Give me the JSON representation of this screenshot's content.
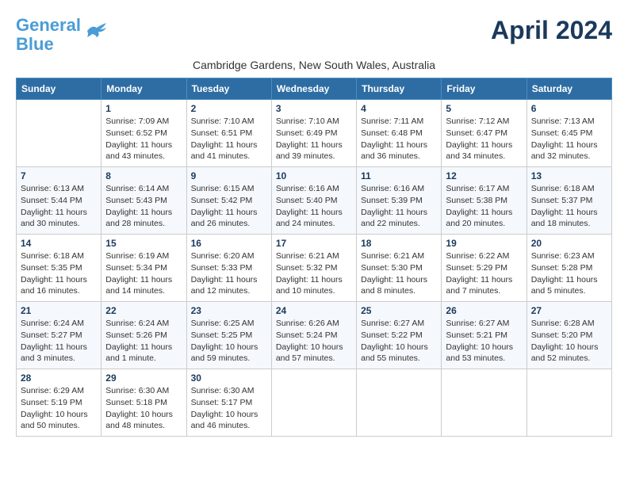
{
  "header": {
    "logo_line1": "General",
    "logo_line2": "Blue",
    "month_title": "April 2024",
    "location": "Cambridge Gardens, New South Wales, Australia"
  },
  "weekdays": [
    "Sunday",
    "Monday",
    "Tuesday",
    "Wednesday",
    "Thursday",
    "Friday",
    "Saturday"
  ],
  "weeks": [
    [
      {
        "day": "",
        "info": ""
      },
      {
        "day": "1",
        "info": "Sunrise: 7:09 AM\nSunset: 6:52 PM\nDaylight: 11 hours\nand 43 minutes."
      },
      {
        "day": "2",
        "info": "Sunrise: 7:10 AM\nSunset: 6:51 PM\nDaylight: 11 hours\nand 41 minutes."
      },
      {
        "day": "3",
        "info": "Sunrise: 7:10 AM\nSunset: 6:49 PM\nDaylight: 11 hours\nand 39 minutes."
      },
      {
        "day": "4",
        "info": "Sunrise: 7:11 AM\nSunset: 6:48 PM\nDaylight: 11 hours\nand 36 minutes."
      },
      {
        "day": "5",
        "info": "Sunrise: 7:12 AM\nSunset: 6:47 PM\nDaylight: 11 hours\nand 34 minutes."
      },
      {
        "day": "6",
        "info": "Sunrise: 7:13 AM\nSunset: 6:45 PM\nDaylight: 11 hours\nand 32 minutes."
      }
    ],
    [
      {
        "day": "7",
        "info": "Sunrise: 6:13 AM\nSunset: 5:44 PM\nDaylight: 11 hours\nand 30 minutes."
      },
      {
        "day": "8",
        "info": "Sunrise: 6:14 AM\nSunset: 5:43 PM\nDaylight: 11 hours\nand 28 minutes."
      },
      {
        "day": "9",
        "info": "Sunrise: 6:15 AM\nSunset: 5:42 PM\nDaylight: 11 hours\nand 26 minutes."
      },
      {
        "day": "10",
        "info": "Sunrise: 6:16 AM\nSunset: 5:40 PM\nDaylight: 11 hours\nand 24 minutes."
      },
      {
        "day": "11",
        "info": "Sunrise: 6:16 AM\nSunset: 5:39 PM\nDaylight: 11 hours\nand 22 minutes."
      },
      {
        "day": "12",
        "info": "Sunrise: 6:17 AM\nSunset: 5:38 PM\nDaylight: 11 hours\nand 20 minutes."
      },
      {
        "day": "13",
        "info": "Sunrise: 6:18 AM\nSunset: 5:37 PM\nDaylight: 11 hours\nand 18 minutes."
      }
    ],
    [
      {
        "day": "14",
        "info": "Sunrise: 6:18 AM\nSunset: 5:35 PM\nDaylight: 11 hours\nand 16 minutes."
      },
      {
        "day": "15",
        "info": "Sunrise: 6:19 AM\nSunset: 5:34 PM\nDaylight: 11 hours\nand 14 minutes."
      },
      {
        "day": "16",
        "info": "Sunrise: 6:20 AM\nSunset: 5:33 PM\nDaylight: 11 hours\nand 12 minutes."
      },
      {
        "day": "17",
        "info": "Sunrise: 6:21 AM\nSunset: 5:32 PM\nDaylight: 11 hours\nand 10 minutes."
      },
      {
        "day": "18",
        "info": "Sunrise: 6:21 AM\nSunset: 5:30 PM\nDaylight: 11 hours\nand 8 minutes."
      },
      {
        "day": "19",
        "info": "Sunrise: 6:22 AM\nSunset: 5:29 PM\nDaylight: 11 hours\nand 7 minutes."
      },
      {
        "day": "20",
        "info": "Sunrise: 6:23 AM\nSunset: 5:28 PM\nDaylight: 11 hours\nand 5 minutes."
      }
    ],
    [
      {
        "day": "21",
        "info": "Sunrise: 6:24 AM\nSunset: 5:27 PM\nDaylight: 11 hours\nand 3 minutes."
      },
      {
        "day": "22",
        "info": "Sunrise: 6:24 AM\nSunset: 5:26 PM\nDaylight: 11 hours\nand 1 minute."
      },
      {
        "day": "23",
        "info": "Sunrise: 6:25 AM\nSunset: 5:25 PM\nDaylight: 10 hours\nand 59 minutes."
      },
      {
        "day": "24",
        "info": "Sunrise: 6:26 AM\nSunset: 5:24 PM\nDaylight: 10 hours\nand 57 minutes."
      },
      {
        "day": "25",
        "info": "Sunrise: 6:27 AM\nSunset: 5:22 PM\nDaylight: 10 hours\nand 55 minutes."
      },
      {
        "day": "26",
        "info": "Sunrise: 6:27 AM\nSunset: 5:21 PM\nDaylight: 10 hours\nand 53 minutes."
      },
      {
        "day": "27",
        "info": "Sunrise: 6:28 AM\nSunset: 5:20 PM\nDaylight: 10 hours\nand 52 minutes."
      }
    ],
    [
      {
        "day": "28",
        "info": "Sunrise: 6:29 AM\nSunset: 5:19 PM\nDaylight: 10 hours\nand 50 minutes."
      },
      {
        "day": "29",
        "info": "Sunrise: 6:30 AM\nSunset: 5:18 PM\nDaylight: 10 hours\nand 48 minutes."
      },
      {
        "day": "30",
        "info": "Sunrise: 6:30 AM\nSunset: 5:17 PM\nDaylight: 10 hours\nand 46 minutes."
      },
      {
        "day": "",
        "info": ""
      },
      {
        "day": "",
        "info": ""
      },
      {
        "day": "",
        "info": ""
      },
      {
        "day": "",
        "info": ""
      }
    ]
  ]
}
